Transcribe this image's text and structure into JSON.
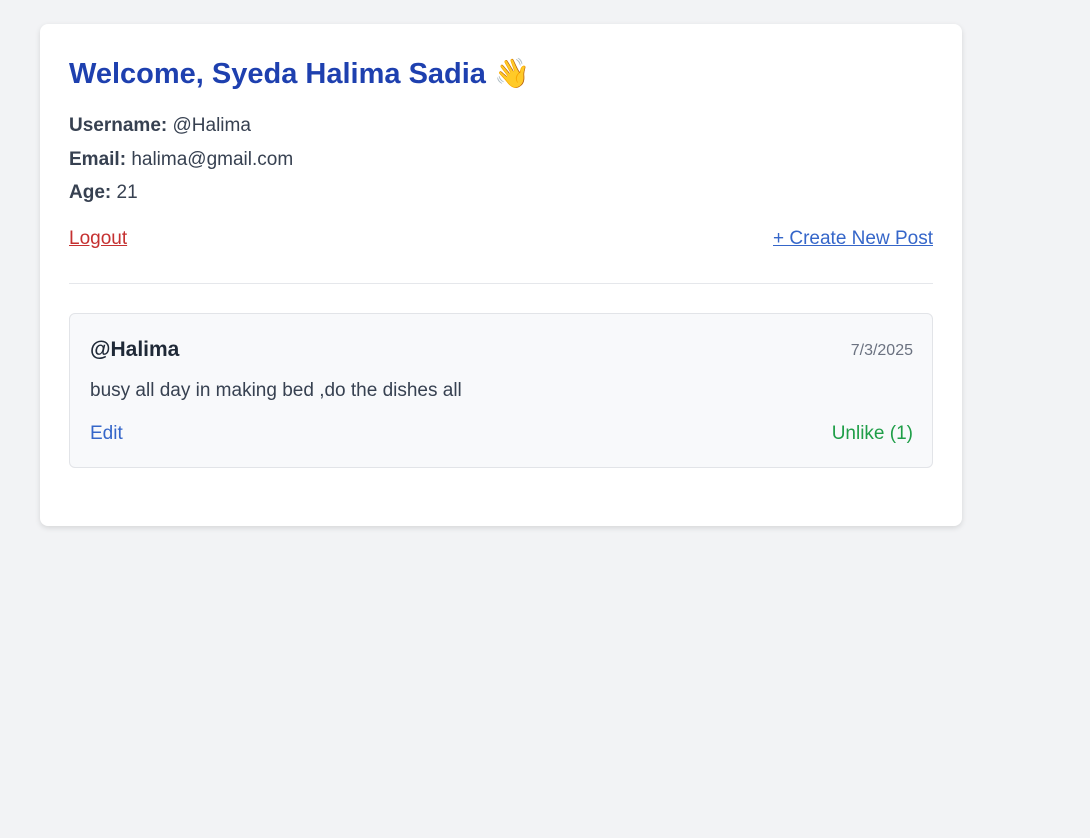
{
  "profile": {
    "welcome_prefix": "Welcome, ",
    "full_name": "Syeda Halima Sadia",
    "wave_emoji": "👋",
    "username_label": "Username:",
    "username_value": "@Halima",
    "email_label": "Email:",
    "email_value": "halima@gmail.com",
    "age_label": "Age:",
    "age_value": "21"
  },
  "actions": {
    "logout_label": "Logout",
    "create_post_label": "+ Create New Post"
  },
  "posts": [
    {
      "author": "@Halima",
      "date": "7/3/2025",
      "content": "busy all day in making bed ,do the dishes all",
      "edit_label": "Edit",
      "like_label": "Unlike (1)"
    }
  ],
  "colors": {
    "page_background": "#f2f3f5",
    "card_background": "#ffffff",
    "title": "#1e40af",
    "logout": "#c53030",
    "link": "#3566c9",
    "like": "#1f9e48"
  }
}
